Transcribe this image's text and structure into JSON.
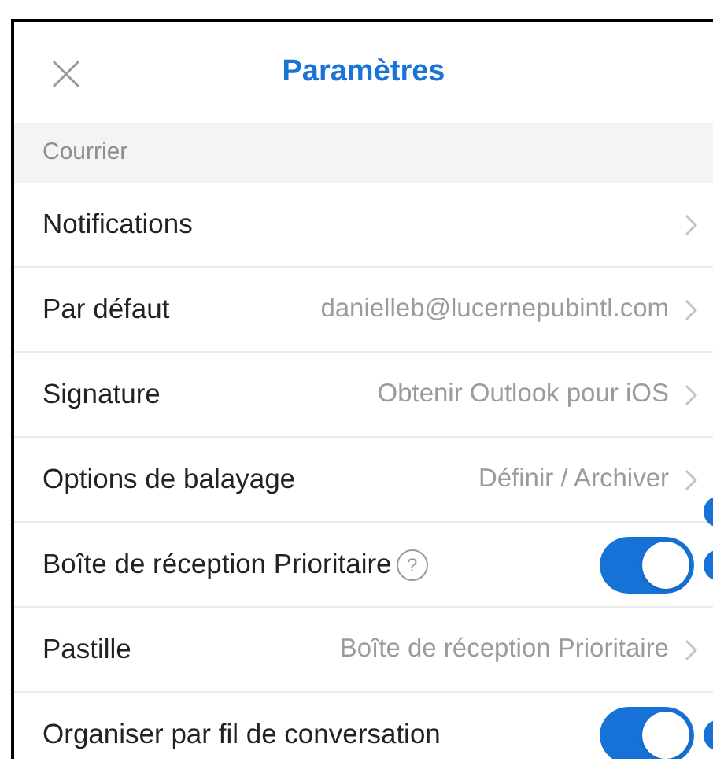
{
  "header": {
    "title": "Paramètres"
  },
  "section": {
    "title": "Courrier"
  },
  "rows": [
    {
      "kind": "link",
      "label": "Notifications",
      "marker": false
    },
    {
      "kind": "link",
      "label": "Par défaut",
      "value": "danielleb@lucernepubintl.com",
      "marker": false
    },
    {
      "kind": "link",
      "label": "Signature",
      "value": "Obtenir Outlook pour iOS",
      "marker": false
    },
    {
      "kind": "link",
      "label": "Options de balayage",
      "value": "Définir / Archiver",
      "marker": true
    },
    {
      "kind": "toggle",
      "label": "Boîte de réception Prioritaire",
      "help": "?",
      "on": true,
      "marker": true
    },
    {
      "kind": "link",
      "label": "Pastille",
      "value": "Boîte de réception Prioritaire",
      "marker": false
    },
    {
      "kind": "toggle",
      "label": "Organiser par fil de conversation",
      "on": true,
      "marker": true
    }
  ]
}
